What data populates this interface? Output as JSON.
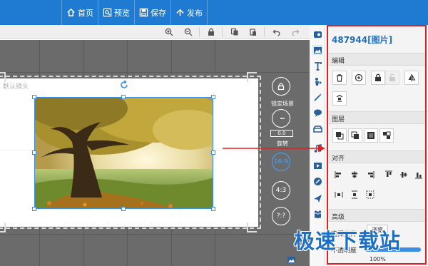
{
  "topbar": {
    "items": [
      {
        "label": "首页",
        "icon": "home-icon"
      },
      {
        "label": "预览",
        "icon": "preview-icon"
      },
      {
        "label": "保存",
        "icon": "save-icon"
      },
      {
        "label": "发布",
        "icon": "publish-icon"
      }
    ],
    "color": "#1f7ad1"
  },
  "toolbar": {
    "icons": [
      "zoom-in-icon",
      "zoom-out-icon",
      "lock-icon",
      "copy-icon",
      "paste-icon",
      "undo-icon",
      "redo-icon"
    ]
  },
  "canvas": {
    "stage_label": "默认镜头",
    "side_controls": {
      "lock_label": "锁定场景",
      "rotate_value": "0.0",
      "rotate_label": "旋转",
      "ratios": [
        "16:9",
        "4:3",
        "?:?"
      ]
    }
  },
  "icon_column": {
    "icons": [
      "background-icon",
      "image-icon",
      "text-icon",
      "character-icon",
      "effect-icon",
      "speech-bubble-icon",
      "prop-icon",
      "music-icon",
      "video-icon",
      "paint-icon",
      "plane-icon",
      "group-icon",
      "thumbnail-icon"
    ]
  },
  "panel": {
    "title": "487944[图片]",
    "sections": {
      "edit": "编辑",
      "layer": "图层",
      "align": "对齐",
      "advanced": "高级"
    },
    "advanced": {
      "replace_label": "选择文件",
      "browse_label": "浏览",
      "opacity_label": "不透明度",
      "opacity_value": "100%"
    }
  },
  "watermark": {
    "text": "极速下载站"
  },
  "accent_colors": {
    "brand_blue": "#1f7ad1",
    "highlight_red": "#e02020",
    "selection_blue": "#3a8ee6"
  }
}
